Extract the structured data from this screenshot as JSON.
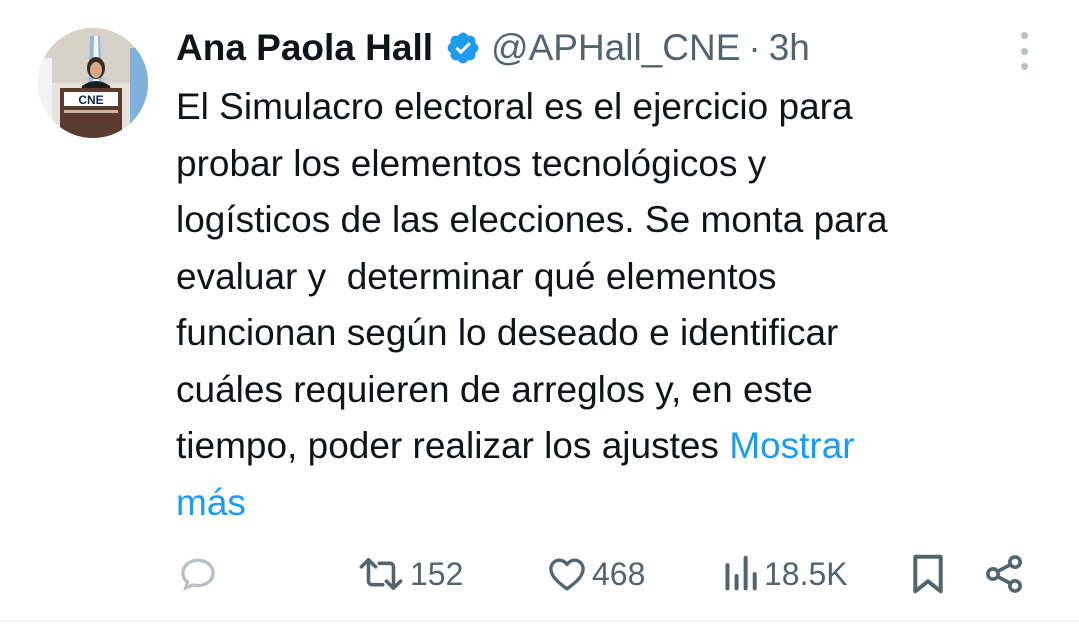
{
  "author": {
    "display_name": "Ana Paola Hall",
    "handle": "@APHall_CNE",
    "separator": "·",
    "timestamp": "3h",
    "avatar_sign_text": "CNE",
    "verified": true
  },
  "tweet": {
    "lines": [
      "El Simulacro electoral es el ejercicio para",
      "probar los elementos tecnológicos y",
      "logísticos de las elecciones. Se monta para",
      "evaluar y  determinar qué elementos",
      "funcionan según lo deseado e identificar",
      "cuáles requieren de arreglos y, en este",
      "tiempo, poder realizar los ajustes "
    ],
    "show_more_part1": "Mostrar",
    "show_more_part2": "más"
  },
  "actions": {
    "reply": {
      "icon": "reply-icon",
      "count": ""
    },
    "retweet": {
      "icon": "retweet-icon",
      "count": "152"
    },
    "like": {
      "icon": "heart-icon",
      "count": "468"
    },
    "views": {
      "icon": "views-icon",
      "count": "18.5K"
    },
    "bookmark": {
      "icon": "bookmark-icon"
    },
    "share": {
      "icon": "share-icon"
    }
  },
  "colors": {
    "link": "#1d9bf0",
    "secondary_text": "#536471",
    "primary_text": "#0f1419",
    "verified_badge": "#1d9bf0"
  }
}
